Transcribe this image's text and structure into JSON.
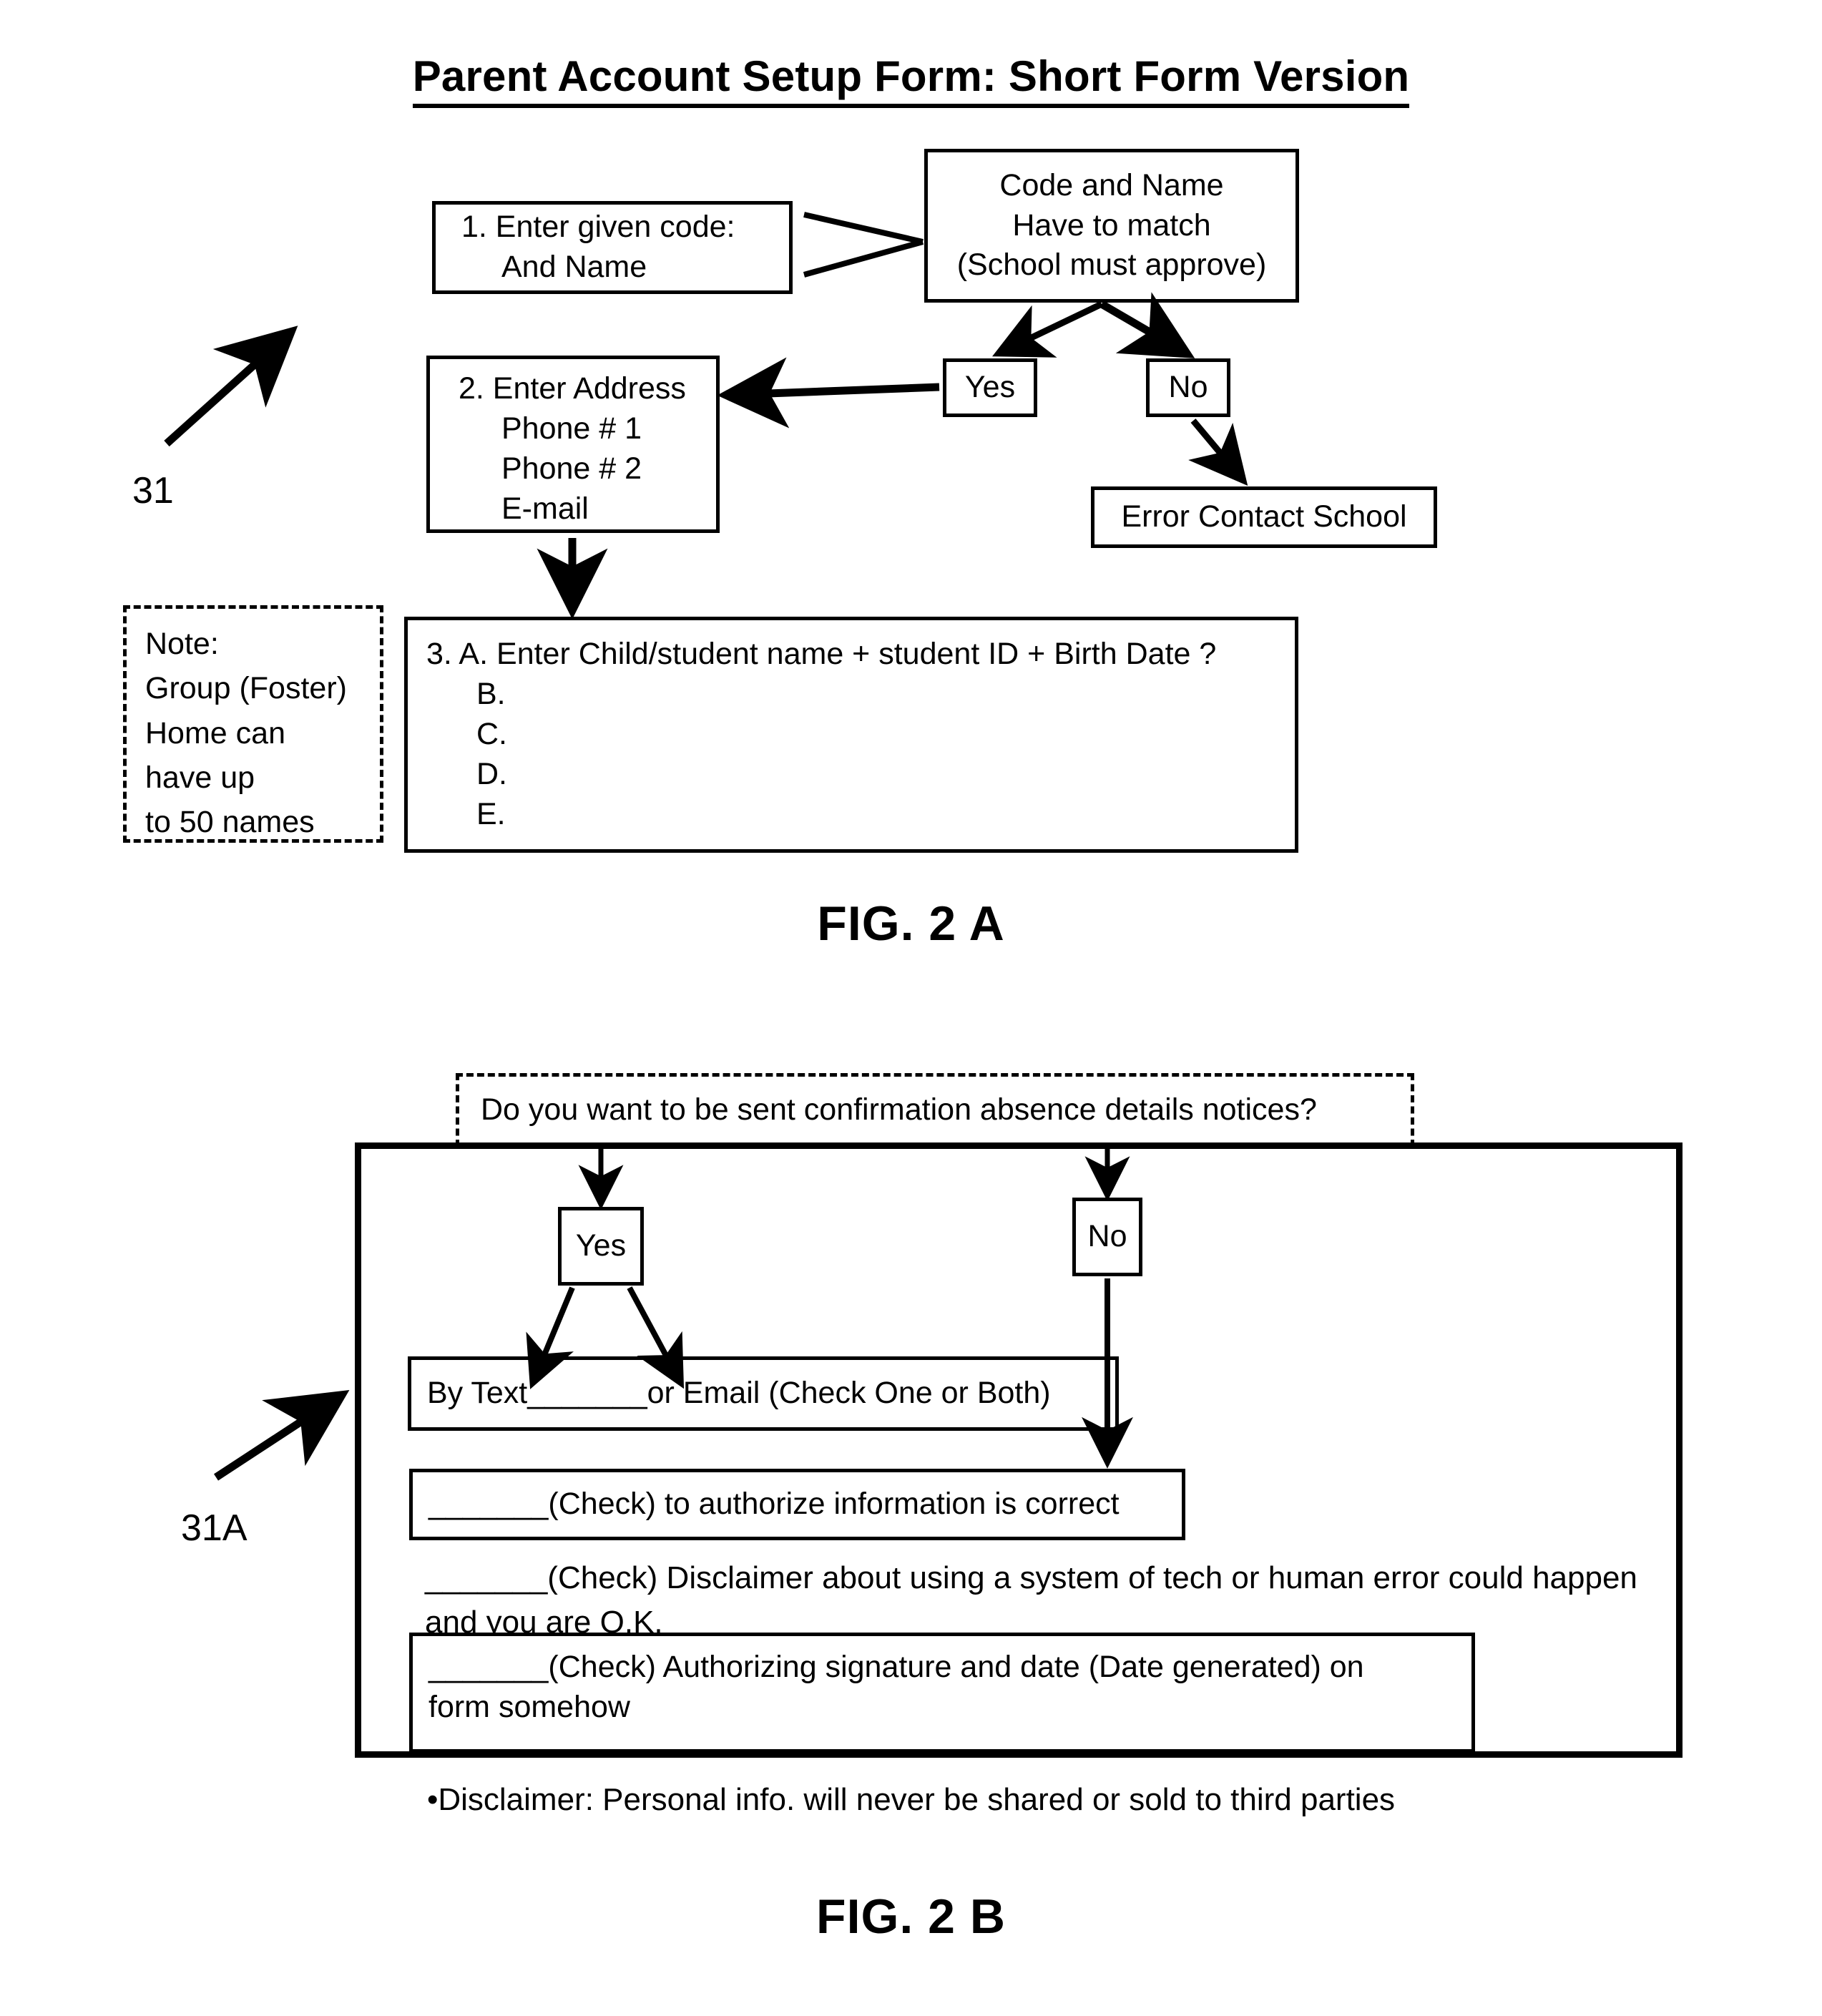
{
  "document": {
    "title": "Parent Account Setup Form:  Short Form Version"
  },
  "fig2a": {
    "caption": "FIG. 2 A",
    "ref_number": "31",
    "step1": {
      "line1": "1.   Enter given code:",
      "line2": "And Name"
    },
    "match_decision": {
      "line1": "Code and Name",
      "line2": "Have to match",
      "line3": "(School must approve)"
    },
    "yes_label": "Yes",
    "no_label": "No",
    "step2": {
      "line1": "2.   Enter Address",
      "line2": "Phone # 1",
      "line3": "Phone # 2",
      "line4": "E-mail"
    },
    "error_box": "Error Contact School",
    "note": {
      "line1": "Note:",
      "line2": "Group (Foster)",
      "line3": "Home can",
      "line4": "have up",
      "line5": "to 50 names"
    },
    "step3": {
      "line_a": "3. A. Enter Child/student name + student ID + Birth Date ?",
      "line_b": "B.",
      "line_c": "C.",
      "line_d": "D.",
      "line_e": "E."
    }
  },
  "fig2b": {
    "caption": "FIG. 2 B",
    "ref_number": "31A",
    "question": "Do you want to be sent confirmation absence details notices?",
    "yes_label": "Yes",
    "no_label": "No",
    "by_text_row": "By Text_______or Email     (Check One or Both)",
    "authorize_row": "_______(Check) to authorize information is correct",
    "disclaimer_row": "_______(Check) Disclaimer about using a system of tech or human error could happen and you are O.K.",
    "signature_row_line1": "_______(Check) Authorizing signature and date (Date generated) on",
    "signature_row_line2": "form somehow",
    "bottom_disclaimer": "•Disclaimer: Personal info. will never be shared or sold to third parties"
  },
  "colors": {
    "ink": "#000000",
    "paper": "#ffffff"
  }
}
